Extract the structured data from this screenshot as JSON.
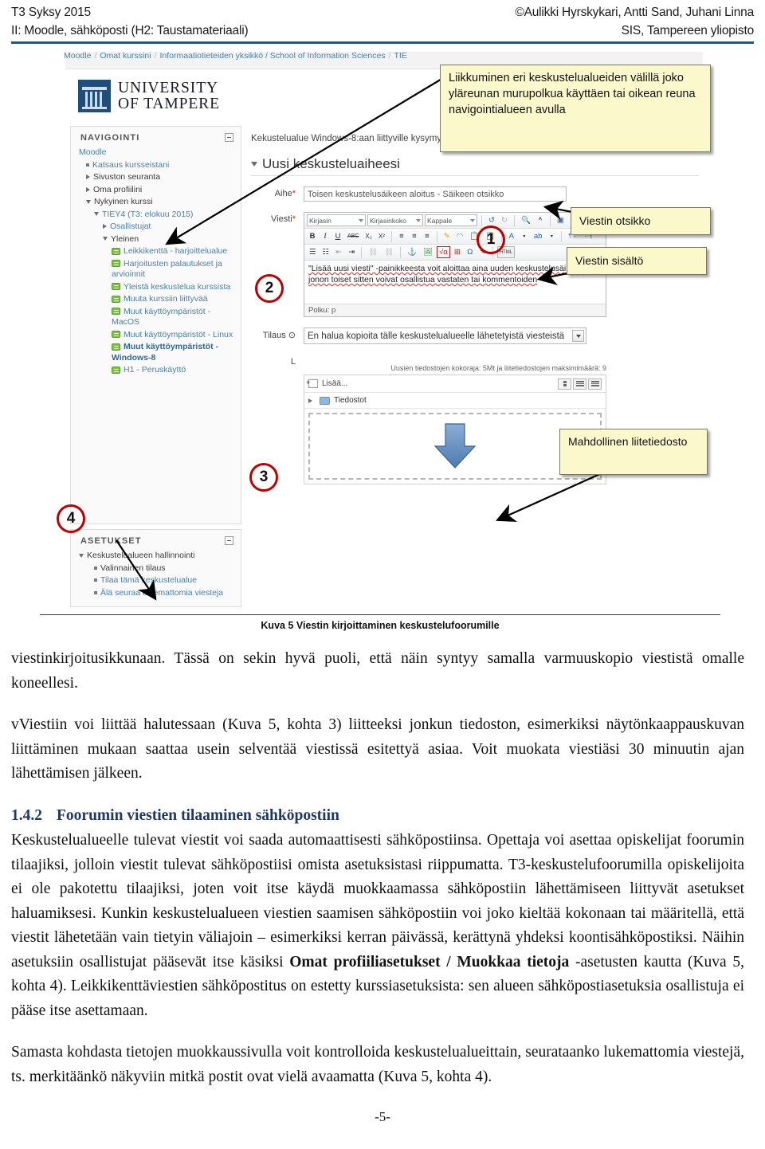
{
  "header": {
    "left_line1": "T3 Syksy 2015",
    "left_line2": "II: Moodle, sähköposti (H2: Taustamateriaali)",
    "right_line1": "©Aulikki Hyrskykari, Antti Sand, Juhani Linna",
    "right_line2": "SIS, Tampereen yliopisto"
  },
  "screenshot": {
    "breadcrumb": {
      "items": [
        "Moodle",
        "Omat kurssini",
        "Informaatiotieteiden yksikkö / School of Information Sciences",
        "TIE"
      ],
      "separator": "/"
    },
    "logo": {
      "line1": "UNIVERSITY",
      "line2": "OF TAMPERE"
    },
    "navigation_block": {
      "title": "NAVIGOINTI",
      "items": [
        {
          "label": "Moodle",
          "indent": 0,
          "marker": "none",
          "style": "link"
        },
        {
          "label": "Katsaus kursseistani",
          "indent": 1,
          "marker": "square",
          "style": "link"
        },
        {
          "label": "Sivuston seuranta",
          "indent": 1,
          "marker": "tri-right",
          "style": "plain"
        },
        {
          "label": "Oma profiilini",
          "indent": 1,
          "marker": "tri-right",
          "style": "plain"
        },
        {
          "label": "Nykyinen kurssi",
          "indent": 1,
          "marker": "tri-down",
          "style": "plain"
        },
        {
          "label": "TIEY4 (T3: elokuu 2015)",
          "indent": 2,
          "marker": "tri-down",
          "style": "link"
        },
        {
          "label": "Osallistujat",
          "indent": 3,
          "marker": "tri-right",
          "style": "link"
        },
        {
          "label": "Yleinen",
          "indent": 3,
          "marker": "tri-down",
          "style": "plain"
        },
        {
          "label": "Leikkikenttä - harjoittelualue",
          "indent": 4,
          "marker": "forum",
          "style": "link"
        },
        {
          "label": "Harjoitusten palautukset ja arvioinnit",
          "indent": 4,
          "marker": "forum",
          "style": "link"
        },
        {
          "label": "Yleistä keskustelua kurssista",
          "indent": 4,
          "marker": "forum",
          "style": "link"
        },
        {
          "label": "Muuta kurssiin liittyvää",
          "indent": 4,
          "marker": "forum",
          "style": "link"
        },
        {
          "label": "Muut käyttöympäristöt - MacOS",
          "indent": 4,
          "marker": "forum",
          "style": "link"
        },
        {
          "label": "Muut käyttöympäristöt - Linux",
          "indent": 4,
          "marker": "forum",
          "style": "link"
        },
        {
          "label": "Muut käyttöympäristöt - Windows-8",
          "indent": 4,
          "marker": "forum",
          "style": "bold"
        },
        {
          "label": "H1 - Peruskäyttö",
          "indent": 4,
          "marker": "forum",
          "style": "link"
        }
      ]
    },
    "settings_block": {
      "title": "ASETUKSET",
      "items": [
        {
          "label": "Keskustelualueen hallinnointi",
          "indent": 0,
          "marker": "tri-down",
          "style": "plain"
        },
        {
          "label": "Valinnainen tilaus",
          "indent": 1,
          "marker": "square",
          "style": "plain"
        },
        {
          "label": "Tilaa tämä keskustelualue",
          "indent": 1,
          "marker": "square",
          "style": "link"
        },
        {
          "label": "Älä seuraa lukemattomia viesteja",
          "indent": 1,
          "marker": "square",
          "style": "link"
        }
      ]
    },
    "forum": {
      "description": "Kekustelualue Windows-8:aan liittyville kysymyksille ja keskusteluille",
      "heading": "Uusi keskusteluaiheesi",
      "subject_label": "Aihe",
      "subject_value": "Toisen keskustelusäikeen aloitus - Säikeen otsikko",
      "message_label": "Viesti",
      "message_text": "\"Lisää uusi viesti\" -painikkeesta voit aloittaa aina uuden keskustelusäikeen, jonon toiset sitten voivat osallistua vastaten tai kommentoiden",
      "editor_path": "Polku: p",
      "editor_toolbar": {
        "font_select": "Kirjasin",
        "size_select": "Kirjasinkoko",
        "style_select": "Kappale",
        "row1_buttons": [
          "undo-icon",
          "redo-icon",
          "find-icon",
          "replace-icon",
          "fullscreen-icon"
        ],
        "row2_buttons": [
          "B",
          "I",
          "U",
          "ABC",
          "X₂",
          "X²",
          "align-left-icon",
          "align-center-icon",
          "align-right-icon",
          "cleanup-icon",
          "eraser-icon",
          "paste-word-icon",
          "paste-text-icon",
          "A",
          "highlight-icon",
          "ltr-icon",
          "rtl-icon"
        ],
        "row3_buttons": [
          "bullet-list-icon",
          "number-list-icon",
          "outdent-icon",
          "indent-icon",
          "undo2-icon",
          "redo2-icon",
          "link-icon",
          "unlink-icon",
          "anchor-icon",
          "image-icon",
          "math-icon",
          "table-icon",
          "omega-icon",
          "edit-icon",
          "HTML"
        ]
      },
      "subscription_label": "Tilaus",
      "subscription_value": "En halua kopioita tälle keskustelualueelle lähetetyistä viesteistä",
      "attachment_label": "L",
      "size_note": "Uusien tiedostojen kokoraja: 5Mt ja liitetiedostojen maksimimäärä: 9",
      "file_add": "Lisää...",
      "file_folder": "Tiedostot"
    },
    "markers": [
      {
        "num": "1"
      },
      {
        "num": "2"
      },
      {
        "num": "3"
      },
      {
        "num": "4"
      }
    ],
    "callouts": {
      "navigation": "Liikkuminen eri keskustelualueiden välillä joko yläreunan murupolkua käyttäen tai oikean reuna navigointialueen avulla",
      "title": "Viestin otsikko",
      "content": "Viestin sisältö",
      "attachment": "Mahdollinen liitetiedosto"
    }
  },
  "caption": "Kuva 5 Viestin kirjoittaminen keskustelufoorumille",
  "body": {
    "para1": "viestinkirjoitusikkunaan. Tässä on sekin hyvä puoli, että näin syntyy samalla varmuuskopio viestistä omalle koneellesi.",
    "para2": "vViestiin voi liittää halutessaan (Kuva 5, kohta 3) liitteeksi jonkun tiedoston, esimerkiksi näytönkaappauskuvan liittäminen mukaan saattaa usein selventää viestissä esitettyä asiaa.  Voit muokata viestiäsi 30 minuutin ajan lähettämisen jälkeen.",
    "section_number": "1.4.2",
    "section_title": "Foorumin viestien tilaaminen sähköpostiin",
    "para3_a": "Keskustelualueelle tulevat viestit voi saada automaattisesti sähköpostiinsa. Opettaja voi asettaa opiskelijat foorumin tilaajiksi, jolloin viestit tulevat sähköpostiisi omista asetuksistasi riippumatta. T3-keskustelufoorumilla opiskelijoita ei ole pakotettu tilaajiksi, joten voit itse käydä muokkaamassa sähköpostiin lähettämiseen liittyvät asetukset haluamiksesi. Kunkin keskustelualueen viestien saamisen sähköpostiin voi joko kieltää kokonaan tai määritellä, että viestit lähetetään vain tietyin väliajoin – esimerkiksi kerran päivässä, kerättynä yhdeksi koontisähköpostiksi. Näihin asetuksiin osallistujat pääsevät itse käsiksi ",
    "para3_bold": "Omat profiiliasetukset / Muokkaa tietoja ",
    "para3_b": "-asetusten kautta (Kuva 5, kohta 4). Leikkikenttäviestien sähköpostitus on estetty kurssiasetuksista: sen alueen sähköpostiasetuksia osallistuja ei pääse itse asettamaan.",
    "para4": "Samasta kohdasta tietojen muokkaussivulla voit kontrolloida keskustelualueittain, seurataanko lukemattomia viestejä, ts. merkitäänkö näkyviin mitkä postit ovat vielä avaamatta (Kuva 5, kohta 4)."
  },
  "page_number": "-5-",
  "colors": {
    "header_rule": "#28557f",
    "callout_bg": "#fbf8cc",
    "marker_red": "#c00000",
    "heading_blue": "#1f3864",
    "link_blue": "#4a7fa8"
  }
}
